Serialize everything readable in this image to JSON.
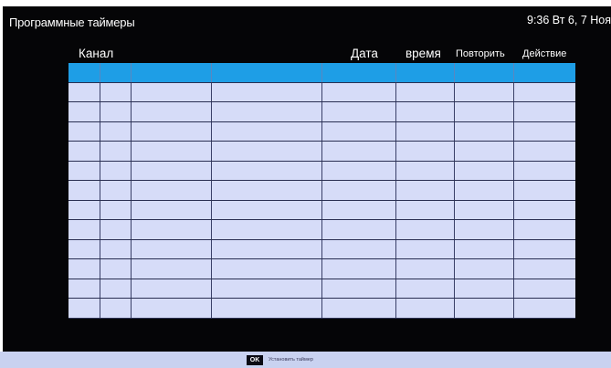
{
  "header": {
    "title": "Программные таймеры",
    "clock": "9:36 Вт 6, 7 Ноя"
  },
  "table": {
    "columns": [
      "Канал",
      "Дата",
      "время",
      "Повторить",
      "Действие"
    ],
    "rows": [
      {
        "selected": true
      },
      {
        "selected": false
      },
      {
        "selected": false
      },
      {
        "selected": false
      },
      {
        "selected": false
      },
      {
        "selected": false
      },
      {
        "selected": false
      },
      {
        "selected": false
      },
      {
        "selected": false
      },
      {
        "selected": false
      },
      {
        "selected": false
      },
      {
        "selected": false
      },
      {
        "selected": false
      }
    ]
  },
  "footer": {
    "ok_key": "OK",
    "ok_label": "Установить таймер"
  },
  "colors": {
    "background": "#050507",
    "selected_row": "#1e9ee6",
    "row": "#d6dcf8",
    "footer": "#c9d2f0"
  }
}
